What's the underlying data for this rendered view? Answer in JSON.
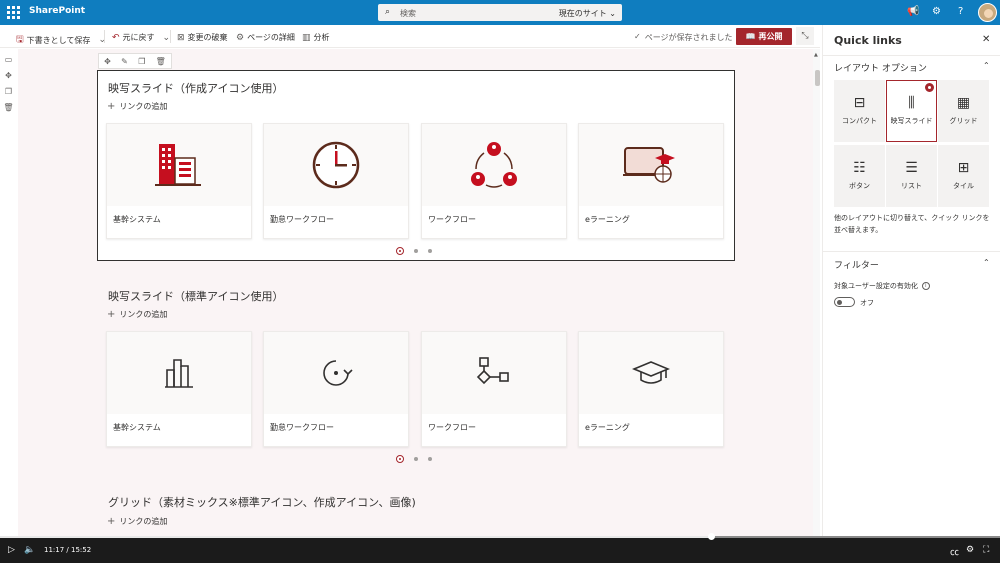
{
  "suite": {
    "app_name": "SharePoint",
    "search_placeholder": "検索",
    "search_scope": "現在のサイト"
  },
  "cmdbar": {
    "save_draft": "下書きとして保存",
    "undo": "元に戻す",
    "discard": "変更の破棄",
    "page_details": "ページの詳細",
    "analytics": "分析",
    "saved_status": "ページが保存されました",
    "republish": "再公開"
  },
  "sections": [
    {
      "title": "映写スライド（作成アイコン使用）",
      "add_link": "リンクの追加",
      "cards": [
        {
          "label": "基幹システム",
          "icon": "building-icon"
        },
        {
          "label": "勤怠ワークフロー",
          "icon": "clock-icon"
        },
        {
          "label": "ワークフロー",
          "icon": "people-cycle-icon"
        },
        {
          "label": "eラーニング",
          "icon": "elearning-icon"
        }
      ]
    },
    {
      "title": "映写スライド（標準アイコン使用）",
      "add_link": "リンクの追加",
      "cards": [
        {
          "label": "基幹システム",
          "icon": "city-icon"
        },
        {
          "label": "勤怠ワークフロー",
          "icon": "rotate-icon"
        },
        {
          "label": "ワークフロー",
          "icon": "flow-icon"
        },
        {
          "label": "eラーニング",
          "icon": "graduation-cap-icon"
        }
      ]
    },
    {
      "title": "グリッド（素材ミックス※標準アイコン、作成アイコン、画像)",
      "add_link": "リンクの追加"
    }
  ],
  "panel": {
    "title": "Quick links",
    "layout_heading": "レイアウト オプション",
    "layouts": [
      {
        "label": "コンパクト",
        "selected": false
      },
      {
        "label": "映写スライド",
        "selected": true
      },
      {
        "label": "グリッド",
        "selected": false
      },
      {
        "label": "ボタン",
        "selected": false
      },
      {
        "label": "リスト",
        "selected": false
      },
      {
        "label": "タイル",
        "selected": false
      }
    ],
    "layout_description": "他のレイアウトに切り替えて、クイック リンクを並べ替えます。",
    "filter_heading": "フィルター",
    "audience_label": "対象ユーザー設定の有効化",
    "toggle_state": "オフ"
  },
  "player": {
    "current_time": "11:17",
    "separator": "/",
    "total_time": "15:52",
    "progress": 0.711
  },
  "colors": {
    "suite": "#0f7dbf",
    "accent": "#a4262c"
  }
}
